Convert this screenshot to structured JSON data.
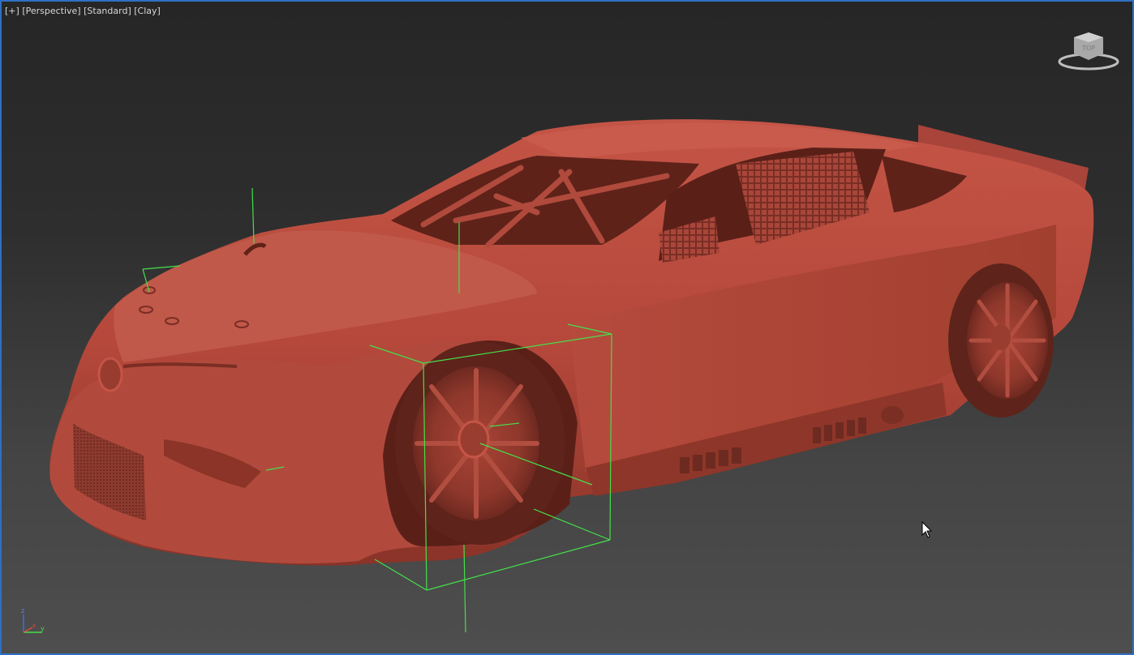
{
  "viewport": {
    "label_plus": "[+]",
    "label_view": "[Perspective]",
    "label_shading": "[Standard]",
    "label_style": "[Clay]",
    "border_color": "#2f6fc4",
    "selection_color": "#44e04a",
    "clay_color": "#b5483b"
  },
  "viewcube": {
    "face_label": "TOP"
  },
  "axis": {
    "z_label": "z",
    "x_label": "x",
    "y_label": "y"
  }
}
